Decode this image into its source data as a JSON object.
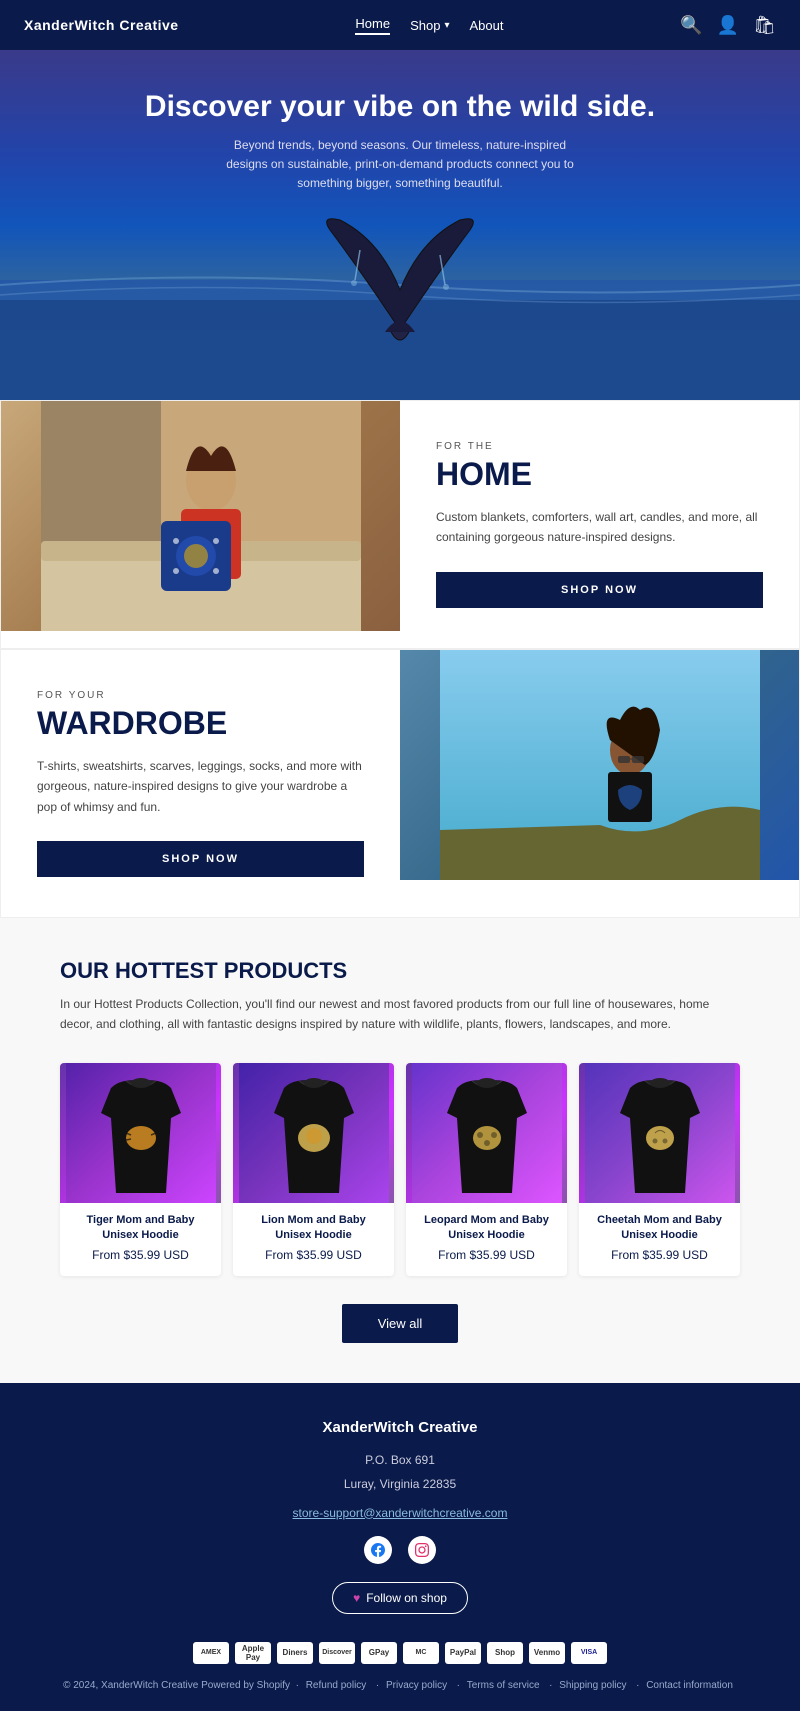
{
  "nav": {
    "brand": "XanderWitch Creative",
    "links": [
      {
        "label": "Home",
        "active": true
      },
      {
        "label": "Shop",
        "has_dropdown": true
      },
      {
        "label": "About",
        "active": false
      }
    ],
    "icons": [
      "search",
      "account",
      "cart"
    ]
  },
  "hero": {
    "title": "Discover your vibe on the wild side.",
    "subtitle": "Beyond trends, beyond seasons. Our timeless, nature-inspired designs on sustainable, print-on-demand products connect you to something bigger, something beautiful."
  },
  "home_section": {
    "for_label": "FOR THE",
    "title": "HOME",
    "desc": "Custom blankets, comforters, wall art, candles, and more, all containing gorgeous nature-inspired designs.",
    "btn": "SHOP NOW"
  },
  "wardrobe_section": {
    "for_label": "FOR YOUR",
    "title": "WARDROBE",
    "desc": "T-shirts, sweatshirts, scarves, leggings, socks, and more with gorgeous, nature-inspired designs to give your wardrobe a pop of whimsy and fun.",
    "btn": "SHOP NOW"
  },
  "products": {
    "title": "OUR HOTTEST PRODUCTS",
    "desc": "In our Hottest Products Collection, you'll find our newest and most favored products from our full line of housewares, home decor, and clothing, all with fantastic designs inspired by nature with wildlife, plants, flowers, landscapes, and more.",
    "view_all": "View all",
    "items": [
      {
        "name": "Tiger Mom and Baby Unisex Hoodie",
        "price": "From $35.99 USD"
      },
      {
        "name": "Lion Mom and Baby Unisex Hoodie",
        "price": "From $35.99 USD"
      },
      {
        "name": "Leopard Mom and Baby Unisex Hoodie",
        "price": "From $35.99 USD"
      },
      {
        "name": "Cheetah Mom and Baby Unisex Hoodie",
        "price": "From $35.99 USD"
      }
    ]
  },
  "footer": {
    "brand": "XanderWitch Creative",
    "address_line1": "P.O. Box 691",
    "address_line2": "Luray, Virginia 22835",
    "email": "store-support@xanderwitchcreative.com",
    "follow_btn": "Follow on shop",
    "payment_methods": [
      "AMEX",
      "Apple Pay",
      "Diners",
      "Discover",
      "Google",
      "Mastercard",
      "PayPal",
      "Shop",
      "Venmo",
      "Visa"
    ],
    "legal": "© 2024, XanderWitch Creative Powered by Shopify",
    "legal_links": [
      "Refund policy",
      "Privacy policy",
      "Terms of service",
      "Shipping policy",
      "Contact information"
    ]
  }
}
